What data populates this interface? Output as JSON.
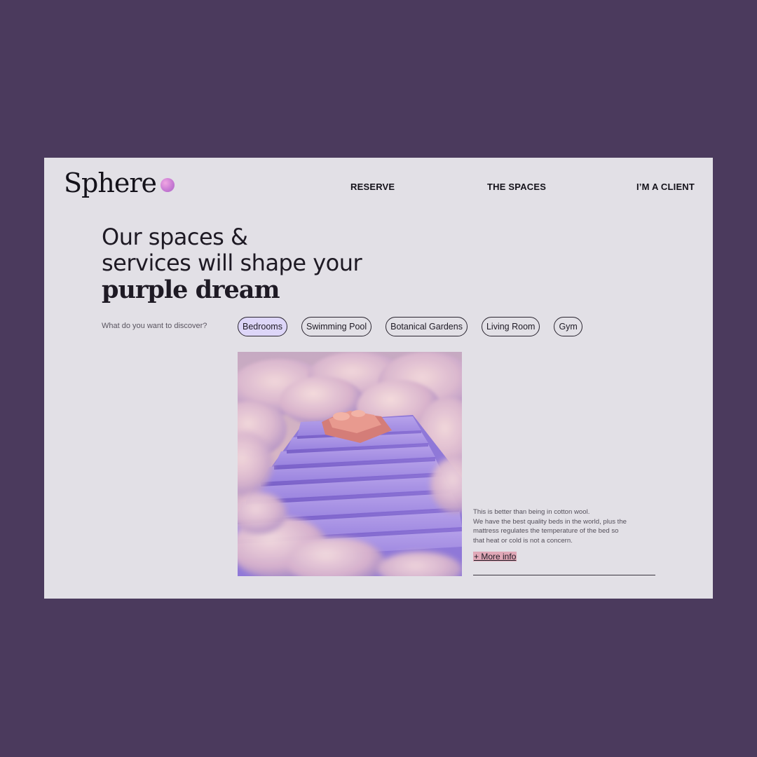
{
  "brand": {
    "name": "Sphere",
    "dot_color": "#c97bd4"
  },
  "nav": {
    "items": [
      {
        "label": "RESERVE"
      },
      {
        "label": "THE SPACES"
      },
      {
        "label": "I’M A CLIENT"
      }
    ]
  },
  "hero": {
    "line1": "Our spaces &",
    "line2": "services will shape your",
    "line3": "purple dream"
  },
  "discover": {
    "label": "What do you want to discover?",
    "selected": "Bedrooms",
    "chips": [
      {
        "label": "Bedrooms",
        "active": true
      },
      {
        "label": "Swimming Pool",
        "active": false
      },
      {
        "label": "Botanical Gardens",
        "active": false
      },
      {
        "label": "Living Room",
        "active": false
      },
      {
        "label": "Gym",
        "active": false
      }
    ]
  },
  "feature": {
    "image_icon": "bed-on-clouds-illustration",
    "description_lines": [
      "This is better than being in cotton wool.",
      "We have the best quality beds in the world, plus the",
      "mattress regulates the temperature of the bed so",
      "that heat or cold is not a concern."
    ],
    "more_info_label": "+ More info"
  },
  "colors": {
    "background": "#4b3a5d",
    "card": "#e2e0e6",
    "active_chip": "#ddd6f8",
    "more_info_highlight": "#e0a8b7"
  }
}
